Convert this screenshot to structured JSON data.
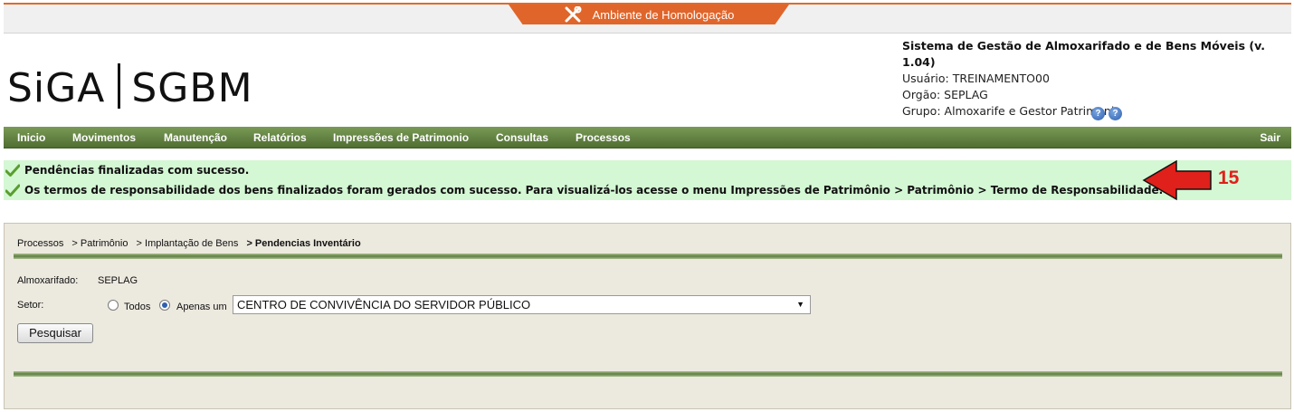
{
  "environment": {
    "label": "Ambiente de Homologação",
    "icon": "tools-icon",
    "color": "#e0652a"
  },
  "logo": {
    "left": "SiGA",
    "right": "SGBM"
  },
  "system_info": {
    "title": "Sistema de Gestão de Almoxarifado e de Bens Móveis (v. 1.04)",
    "user": "Usuário: TREINAMENTO00",
    "org": "Orgão: SEPLAG",
    "group": "Grupo: Almoxarife e Gestor Patrimonio",
    "help_icons": [
      "help-icon",
      "help-icon"
    ]
  },
  "menu": {
    "items": [
      "Inicio",
      "Movimentos",
      "Manutenção",
      "Relatórios",
      "Impressões de Patrimonio",
      "Consultas",
      "Processos"
    ],
    "logout": "Sair",
    "color": "#5f7e3d"
  },
  "messages": [
    "Pendências finalizadas com sucesso.",
    "Os termos de responsabilidade dos bens finalizados foram gerados com sucesso. Para visualizá-los acesse o menu Impressões de Patrimônio > Patrimônio > Termo de Responsabilidade."
  ],
  "annotation": {
    "number": "15",
    "color": "#e0201a"
  },
  "breadcrumb": {
    "items": [
      "Processos",
      "> Patrimônio",
      "> Implantação de Bens"
    ],
    "current": "> Pendencias Inventário"
  },
  "form": {
    "almoxarifado_label": "Almoxarifado:",
    "almoxarifado_value": "SEPLAG",
    "setor_label": "Setor:",
    "option_all": "Todos",
    "option_only": "Apenas um",
    "selected_option": "Apenas um",
    "sector_value": "CENTRO DE CONVIVÊNCIA DO SERVIDOR PÚBLICO",
    "search_button": "Pesquisar"
  }
}
